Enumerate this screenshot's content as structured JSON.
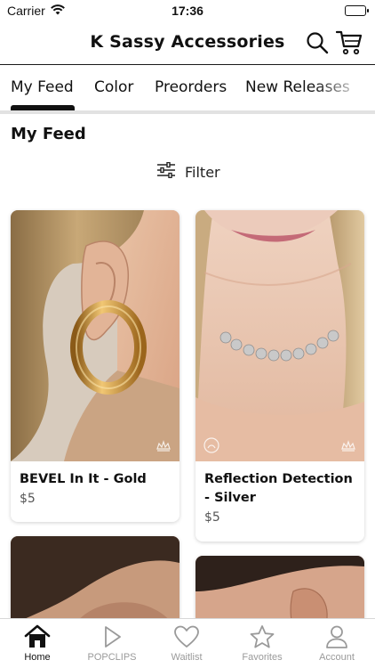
{
  "status_bar": {
    "carrier": "Carrier",
    "time": "17:36"
  },
  "header": {
    "title": "K Sassy Accessories",
    "search_icon": "search-icon",
    "cart_icon": "cart-icon"
  },
  "tabs": [
    {
      "label": "My Feed",
      "active": true
    },
    {
      "label": "Color"
    },
    {
      "label": "Preorders"
    },
    {
      "label": "New Releases"
    }
  ],
  "section_title": "My Feed",
  "filter": {
    "label": "Filter",
    "icon": "sliders-icon"
  },
  "products": [
    {
      "name": "BEVEL In It - Gold",
      "price": "$5"
    },
    {
      "name": "Reflection Detection - Silver",
      "price": "$5"
    }
  ],
  "bottom_nav": [
    {
      "label": "Home",
      "icon": "home-icon",
      "active": true
    },
    {
      "label": "POPCLIPS",
      "icon": "play-icon"
    },
    {
      "label": "Waitlist",
      "icon": "heart-icon"
    },
    {
      "label": "Favorites",
      "icon": "star-icon"
    },
    {
      "label": "Account",
      "icon": "account-icon"
    }
  ],
  "colors": {
    "text": "#111111",
    "muted": "#9a9a9a",
    "tab_track": "#e2e2e2"
  }
}
